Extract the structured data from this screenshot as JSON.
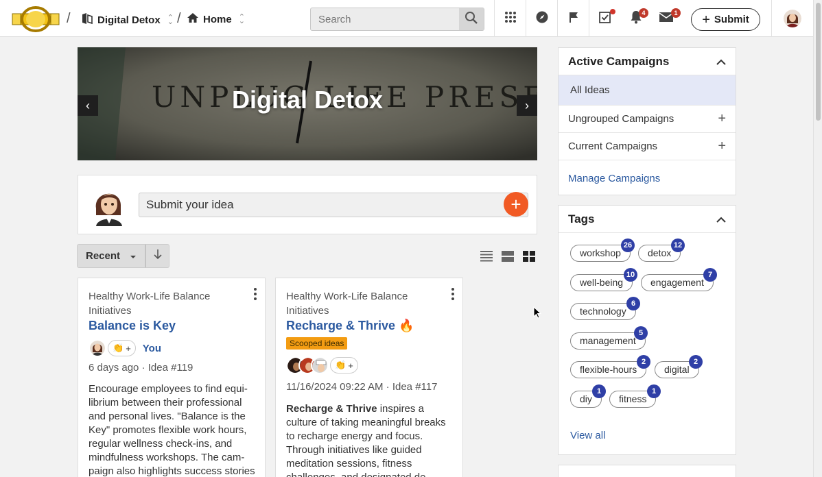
{
  "header": {
    "breadcrumbs": [
      {
        "label": "Digital Detox",
        "icon": "community-icon"
      },
      {
        "label": "Home",
        "icon": "home-icon"
      }
    ],
    "search_placeholder": "Search",
    "notifications_count": "4",
    "messages_count": "1",
    "submit_label": "Submit"
  },
  "banner": {
    "background_text": "UNPLUG LIFE PRESENT",
    "title": "Digital Detox"
  },
  "idea_input": {
    "placeholder": "Submit your idea"
  },
  "sort": {
    "label": "Recent"
  },
  "cards": [
    {
      "campaign": "Healthy Work-Life Balance Initiatives",
      "title": "Balance is Key",
      "you_label": "You",
      "meta": "6 days ago · Idea #119",
      "body": "Encourage employees to find equi­librium between their professional and personal lives. \"Balance is the Key\" promotes flexible work hours, regular wellness check-ins, and mindfulness workshops. The cam­paign also highlights success stories"
    },
    {
      "campaign": "Healthy Work-Life Balance Initiatives",
      "title": "Recharge & Thrive",
      "title_emoji": "🔥",
      "badge": "Scooped ideas",
      "meta": "11/16/2024 09:22 AM · Idea #117",
      "body_bold": "Recharge & Thrive",
      "body": " inspires a culture of taking meaningful breaks to recharge energy and focus. Through initiatives like guided meditation sessions, fitness challenges, and designated de-connection areas, the"
    }
  ],
  "campaigns": {
    "title": "Active Campaigns",
    "items": [
      {
        "label": "All Ideas"
      },
      {
        "label": "Ungrouped Campaigns"
      },
      {
        "label": "Current Campaigns"
      }
    ],
    "manage_label": "Manage Campaigns"
  },
  "tags": {
    "title": "Tags",
    "items": [
      {
        "label": "workshop",
        "count": "26"
      },
      {
        "label": "detox",
        "count": "12"
      },
      {
        "label": "well-being",
        "count": "10"
      },
      {
        "label": "engagement",
        "count": "7"
      },
      {
        "label": "technology",
        "count": "6"
      },
      {
        "label": "management",
        "count": "5"
      },
      {
        "label": "flexible-hours",
        "count": "2"
      },
      {
        "label": "digital",
        "count": "2"
      },
      {
        "label": "diy",
        "count": "1"
      },
      {
        "label": "fitness",
        "count": "1"
      }
    ],
    "view_all_label": "View all"
  },
  "colors": {
    "accent_link": "#2c5aa0",
    "plus_button": "#f15a24",
    "tag_count": "#2f3fa6",
    "badge_red": "#c0392b",
    "scooped": "#f39c12"
  }
}
